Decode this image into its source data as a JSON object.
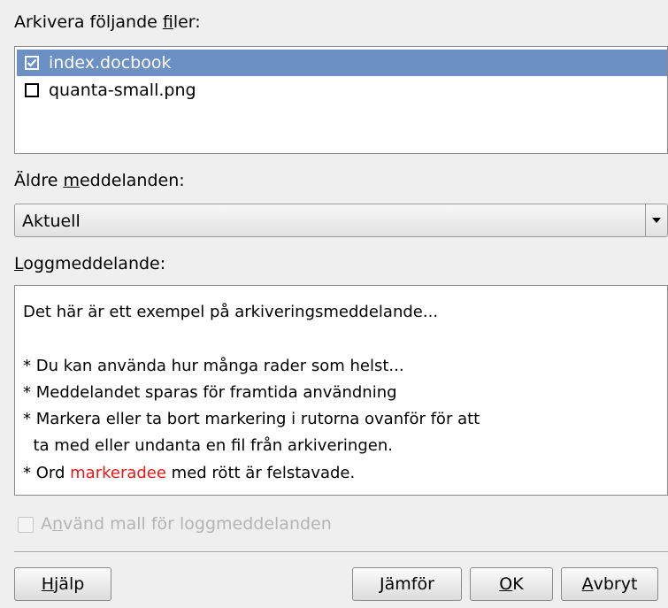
{
  "files_section": {
    "label_prefix": "Arkivera följande ",
    "label_mnemonic": "f",
    "label_suffix": "iler:",
    "files": [
      {
        "name": "index.docbook",
        "checked": true,
        "selected": true
      },
      {
        "name": "quanta-small.png",
        "checked": false,
        "selected": false
      }
    ]
  },
  "older_messages": {
    "label_prefix": "Äldre ",
    "label_mnemonic": "m",
    "label_suffix": "eddelanden:",
    "selected_value": "Aktuell"
  },
  "log_message": {
    "label_mnemonic": "L",
    "label_suffix": "oggmeddelande:",
    "lines": [
      "Det här är ett exempel på arkiveringsmeddelande...",
      "",
      "* Du kan använda hur många rader som helst...",
      "* Meddelandet sparas för framtida användning",
      "* Markera eller ta bort markering i rutorna ovanför för att",
      "  ta med eller undanta en fil från arkiveringen."
    ],
    "last_line_before": "* Ord ",
    "last_line_misspelled": "markeradee",
    "last_line_after": " med rött är felstavade.",
    "misspelled_color": "#e81818"
  },
  "template_checkbox": {
    "label_prefix": "A",
    "label_mnemonic": "n",
    "label_suffix": "vänd mall för loggmeddelanden",
    "checked": false,
    "enabled": false
  },
  "buttons": {
    "help_mnemonic": "H",
    "help_rest": "jälp",
    "compare_mnemonic": "J",
    "compare_rest": "ämför",
    "ok_mnemonic": "O",
    "ok_rest": "K",
    "cancel_mnemonic": "A",
    "cancel_rest": "vbryt"
  },
  "colors": {
    "selection": "#6c8fc4",
    "background": "#efefef"
  }
}
